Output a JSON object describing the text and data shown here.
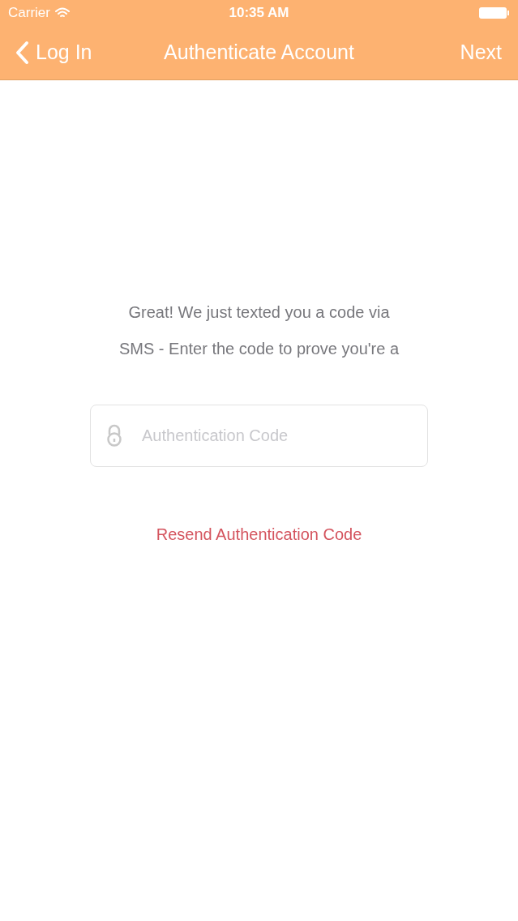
{
  "status_bar": {
    "carrier": "Carrier",
    "time": "10:35 AM"
  },
  "nav_bar": {
    "back_label": "Log In",
    "title": "Authenticate Account",
    "action": "Next"
  },
  "message_lines": [
    "Great! We just texted you a code via",
    "SMS - Enter the code to prove you're a"
  ],
  "code_field": {
    "placeholder": "Authentication Code"
  },
  "resend_link": "Resend Authentication Code"
}
